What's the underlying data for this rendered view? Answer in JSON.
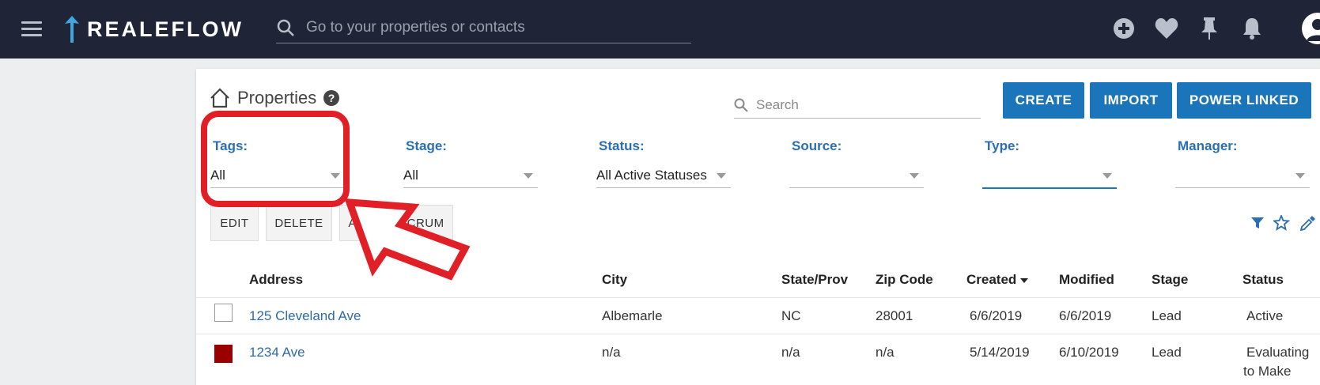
{
  "app": {
    "name": "REALEFLOW"
  },
  "topbar": {
    "search_placeholder": "Go to your properties or contacts",
    "icons": [
      "plus-circle-icon",
      "heart-icon",
      "pin-icon",
      "bell-icon",
      "user-avatar-icon"
    ]
  },
  "page": {
    "title": "Properties",
    "search_placeholder": "Search"
  },
  "buttons": {
    "create": "CREATE",
    "import": "IMPORT",
    "power_linked": "POWER LINKED"
  },
  "filters": [
    {
      "label": "Tags:",
      "value": "All"
    },
    {
      "label": "Stage:",
      "value": "All"
    },
    {
      "label": "Status:",
      "value": "All Active Statuses"
    },
    {
      "label": "Source:",
      "value": ""
    },
    {
      "label": "Type:",
      "value": ""
    },
    {
      "label": "Manager:",
      "value": ""
    }
  ],
  "actions": {
    "edit": "EDIT",
    "delete": "DELETE",
    "add_to_scrum": "ADD TO SCRUM"
  },
  "table": {
    "columns": [
      "Address",
      "City",
      "State/Prov",
      "Zip Code",
      "Created",
      "Modified",
      "Stage",
      "Status"
    ],
    "rows": [
      {
        "address": "125 Cleveland Ave",
        "city": "Albemarle",
        "state": "NC",
        "zip": "28001",
        "created": "6/6/2019",
        "modified": "6/6/2019",
        "stage": "Lead",
        "status": "Active",
        "status2": "",
        "color": "#ffffff"
      },
      {
        "address": "1234 Ave",
        "city": "n/a",
        "state": "n/a",
        "zip": "n/a",
        "created": "5/14/2019",
        "modified": "6/10/2019",
        "stage": "Lead",
        "status": "Evaluating",
        "status2": "to Make",
        "color": "#9b0000"
      }
    ]
  },
  "colors": {
    "topbar": "#1f2537",
    "primary": "#1b75bb",
    "annotation": "#e01f26"
  }
}
